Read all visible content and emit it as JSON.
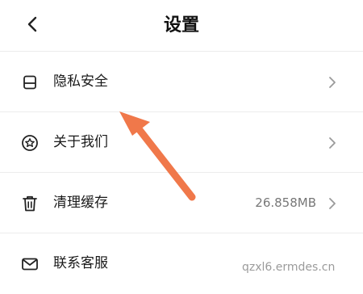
{
  "header": {
    "title": "设置",
    "back_icon": "chevron-left-icon"
  },
  "settings": {
    "items": [
      {
        "label": "隐私安全",
        "icon": "document-icon",
        "value": ""
      },
      {
        "label": "关于我们",
        "icon": "star-badge-icon",
        "value": ""
      },
      {
        "label": "清理缓存",
        "icon": "trash-icon",
        "value": "26.858MB"
      },
      {
        "label": "联系客服",
        "icon": "mail-icon",
        "value": ""
      }
    ]
  },
  "annotation": {
    "arrow_color": "#f0784a"
  },
  "watermark": {
    "text": "qzxl6.ermdes.cn"
  }
}
